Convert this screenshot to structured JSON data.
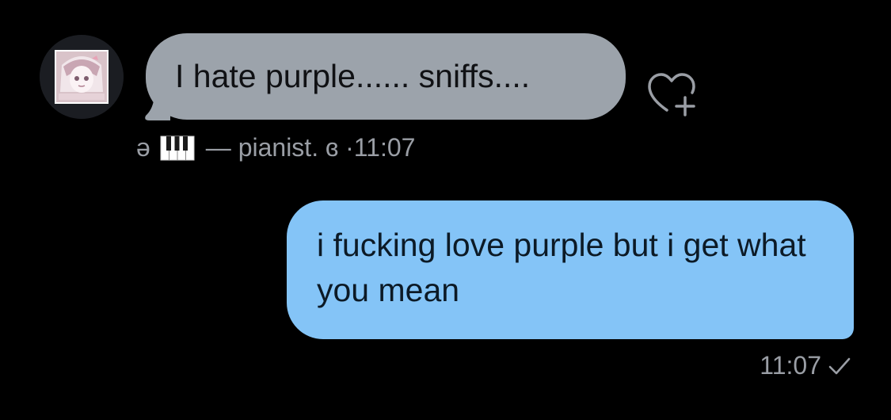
{
  "incoming": {
    "text": "I hate purple...... sniffs....",
    "sender_prefix": "ə",
    "sender_icon": "piano-keys-icon",
    "sender_name": "— pianist. ɞ",
    "time": "·11:07",
    "avatar_icon": "anime-avatar-icon",
    "react_icon": "heart-plus-icon"
  },
  "outgoing": {
    "text": "i fucking love purple but i get what you mean",
    "time": "11:07",
    "status_icon": "checkmark-icon"
  },
  "colors": {
    "background": "#000000",
    "incoming_bubble": "#9ca3ab",
    "outgoing_bubble": "#84c4f7",
    "meta_text": "#9a9ea5"
  }
}
